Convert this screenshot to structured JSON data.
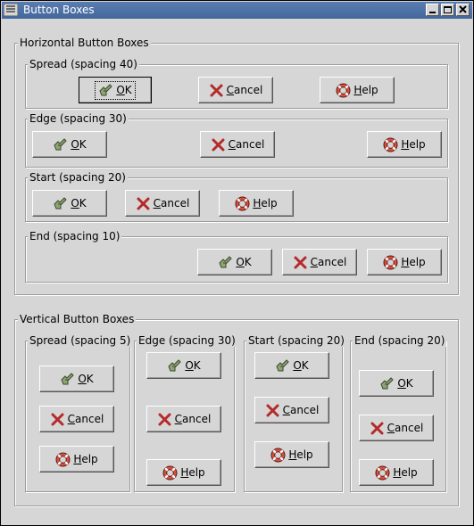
{
  "window": {
    "title": "Button Boxes"
  },
  "horizontal": {
    "label": "Horizontal Button Boxes",
    "spread": {
      "label": "Spread (spacing 40)"
    },
    "edge": {
      "label": "Edge (spacing 30)"
    },
    "start": {
      "label": "Start (spacing 20)"
    },
    "end": {
      "label": "End (spacing 10)"
    }
  },
  "vertical": {
    "label": "Vertical Button Boxes",
    "spread": {
      "label": "Spread (spacing 5)"
    },
    "edge": {
      "label": "Edge (spacing 30)"
    },
    "start": {
      "label": "Start (spacing 20)"
    },
    "end": {
      "label": "End (spacing 20)"
    }
  },
  "buttons": {
    "ok": {
      "mnemonic": "O",
      "rest": "K"
    },
    "cancel": {
      "mnemonic": "C",
      "rest": "ancel"
    },
    "help": {
      "mnemonic": "H",
      "rest": "elp"
    }
  },
  "icons": {
    "ok": "ok-hand-icon",
    "cancel": "red-x-icon",
    "help": "life-buoy-icon"
  }
}
